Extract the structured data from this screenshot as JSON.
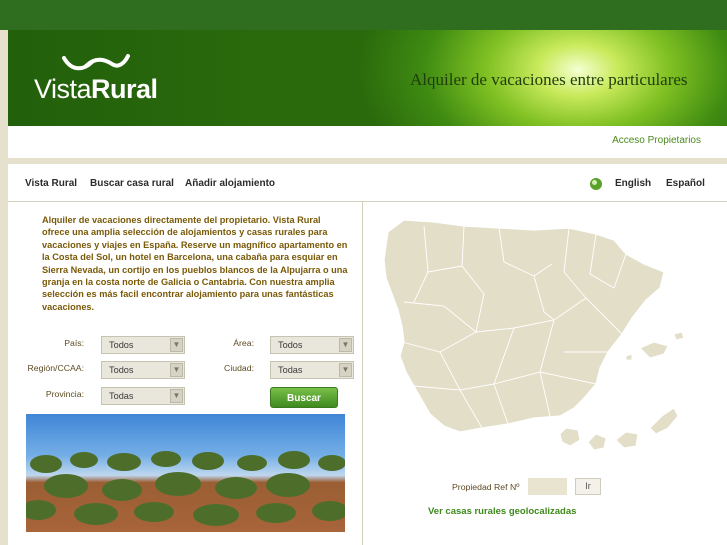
{
  "header": {
    "logo_light": "Vista",
    "logo_bold": "Rural",
    "tagline": "Alquiler de vacaciones entre particulares",
    "owner_link": "Acceso Propietarios"
  },
  "nav": {
    "items": [
      "Vista Rural",
      "Buscar casa rural",
      "Añadir alojamiento"
    ],
    "languages": [
      "English",
      "Español"
    ]
  },
  "intro_text": "Alquiler de vacaciones directamente del propietario. Vista Rural ofrece una amplia selección de alojamientos y casas rurales para vacaciones y viajes en España. Reserve un magnífico apartamento en la Costa del Sol, un hotel en Barcelona, una cabaña para esquiar en Sierra Nevada, un cortijo en los pueblos blancos de la Alpujarra o una granja en la costa norte de Galicia o Cantabria. Con nuestra amplia selección es más facil encontrar alojamiento para unas fantásticas vacaciones.",
  "search_form": {
    "pais_label": "País:",
    "pais_value": "Todos",
    "area_label": "Área:",
    "area_value": "Todos",
    "region_label": "Región/CCAA:",
    "region_value": "Todos",
    "ciudad_label": "Ciudad:",
    "ciudad_value": "Todas",
    "provincia_label": "Provincia:",
    "provincia_value": "Todas",
    "search_button": "Buscar"
  },
  "map_panel": {
    "ref_label": "Propiedad Ref Nº",
    "ref_value": "",
    "go_button": "Ir",
    "geo_link": "Ver casas rurales geolocalizadas"
  },
  "colors": {
    "brand_dark_green": "#2f6d1f",
    "link_green": "#4a8a1e",
    "intro_brown": "#7a5a08",
    "map_fill": "#e3dec8"
  }
}
